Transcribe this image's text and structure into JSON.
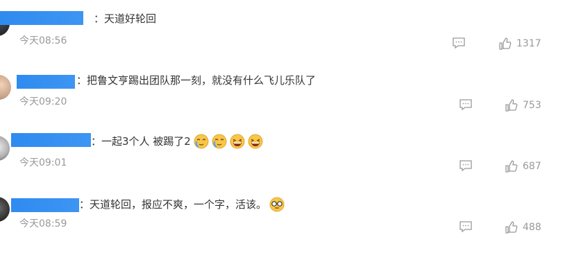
{
  "comments": [
    {
      "text": "：天道好轮回",
      "time": "今天08:56",
      "likes": "1317",
      "emojis": []
    },
    {
      "text": "：把鲁文亨踢出团队那一刻，就没有什么飞儿乐队了",
      "time": "今天09:20",
      "likes": "753",
      "emojis": []
    },
    {
      "text": "：一起3个人 被踢了2",
      "time": "今天09:01",
      "likes": "687",
      "emojis": [
        "crying-face-icon",
        "crying-face-icon",
        "laughing-face-icon",
        "laughing-face-icon"
      ]
    },
    {
      "text": "：天道轮回，报应不爽，一个字，活该。",
      "time": "今天08:59",
      "likes": "488",
      "emojis": [
        "glasses-face-icon"
      ]
    }
  ],
  "colors": {
    "name_mask": "#2f8bf0",
    "meta_gray": "#999999",
    "text": "#333333",
    "emoji_yellow": "#f7c64a"
  }
}
